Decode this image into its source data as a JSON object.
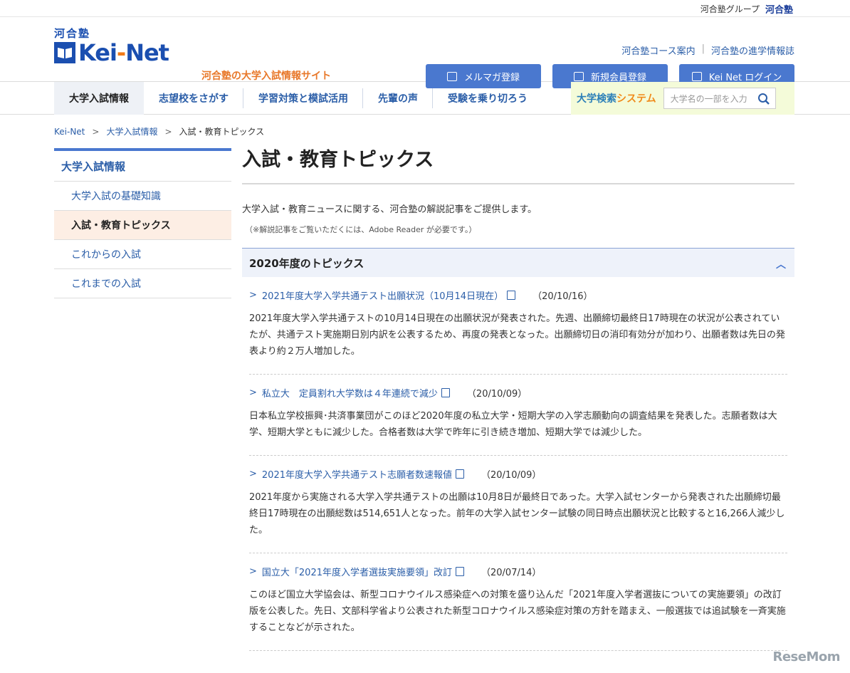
{
  "topbar": {
    "group_label": "河合塾グループ",
    "group_logo": "河合塾"
  },
  "logo": {
    "kawai": "河合塾",
    "name_a": "Kei",
    "name_b": "-",
    "name_c": "Net",
    "tagline": "河合塾の大学入試情報サイト"
  },
  "header": {
    "links": [
      "河合塾コース案内",
      "河合塾の進学情報誌"
    ],
    "buttons": [
      {
        "label": "メルマガ登録",
        "icon": "mail-icon"
      },
      {
        "label": "新規会員登録",
        "icon": "user-icon"
      },
      {
        "label": "Kei Net ログイン",
        "icon": "login-icon"
      }
    ]
  },
  "nav": {
    "items": [
      "大学入試情報",
      "志望校をさがす",
      "学習対策と模試活用",
      "先輩の声",
      "受験を乗り切ろう"
    ],
    "search_title_a": "大学検索",
    "search_title_b": "システム",
    "search_placeholder": "大学名の一部を入力"
  },
  "breadcrumb": [
    "Kei-Net",
    "大学入試情報",
    "入試・教育トピックス"
  ],
  "sidebar": {
    "title": "大学入試情報",
    "items": [
      "大学入試の基礎知識",
      "入試・教育トピックス",
      "これからの入試",
      "これまでの入試"
    ]
  },
  "main": {
    "title": "入試・教育トピックス",
    "intro": "大学入試・教育ニュースに関する、河合塾の解説記事をご提供します。",
    "note": "（※解説記事をご覧いただくには、Adobe Reader が必要です。）",
    "section_title": "2020年度のトピックス",
    "articles": [
      {
        "title": "2021年度大学入学共通テスト出願状況（10月14日現在）",
        "date": "（20/10/16）",
        "body": "2021年度大学入学共通テストの10月14日現在の出願状況が発表された。先週、出願締切最終日17時現在の状況が公表されていたが、共通テスト実施期日別内訳を公表するため、再度の発表となった。出願締切日の消印有効分が加わり、出願者数は先日の発表より約２万人増加した。"
      },
      {
        "title": "私立大　定員割れ大学数は４年連続で減少",
        "date": "（20/10/09）",
        "body": "日本私立学校振興･共済事業団がこのほど2020年度の私立大学・短期大学の入学志願動向の調査結果を発表した。志願者数は大学、短期大学ともに減少した。合格者数は大学で昨年に引き続き増加、短期大学では減少した。"
      },
      {
        "title": "2021年度大学入学共通テスト志願者数速報値",
        "date": "（20/10/09）",
        "body": "2021年度から実施される大学入学共通テストの出願は10月8日が最終日であった。大学入試センターから発表された出願締切最終日17時現在の出願総数は514,651人となった。前年の大学入試センター試験の同日時点出願状況と比較すると16,266人減少した。"
      },
      {
        "title": "国立大「2021年度入学者選抜実施要領」改訂",
        "date": "（20/07/14）",
        "body": "このほど国立大学協会は、新型コロナウイルス感染症への対策を盛り込んだ「2021年度入学者選抜についての実施要領」の改訂版を公表した。先日、文部科学省より公表された新型コロナウイルス感染症対策の方針を踏まえ、一般選抜では追試験を一斉実施することなどが示された。"
      }
    ]
  },
  "watermark": "ReseMom",
  "colors": {
    "brand": "#1b4fb0",
    "accent": "#f07a19",
    "button": "#4a78cf",
    "link": "#2b5ea8"
  }
}
